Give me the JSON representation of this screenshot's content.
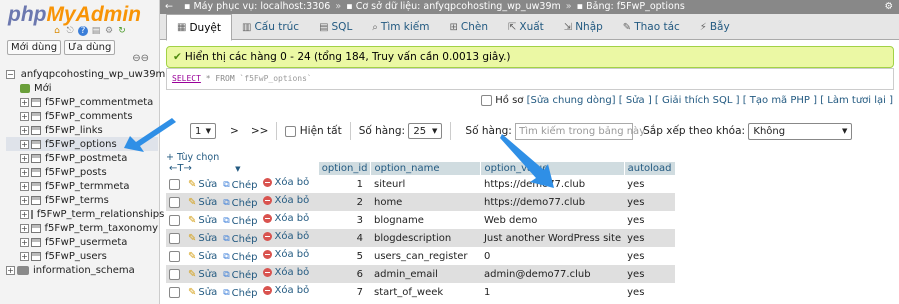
{
  "left": {
    "logo_a": "php",
    "logo_b": "MyAdmin",
    "recent_label": "Mới dùng",
    "favorites_label": "Ưa dùng",
    "database": "anfyqpcohosting_wp_uw39m",
    "new_label": "Mới",
    "tables": [
      "f5FwP_commentmeta",
      "f5FwP_comments",
      "f5FwP_links",
      "f5FwP_options",
      "f5FwP_postmeta",
      "f5FwP_posts",
      "f5FwP_termmeta",
      "f5FwP_terms",
      "f5FwP_term_relationships",
      "f5FwP_term_taxonomy",
      "f5FwP_usermeta",
      "f5FwP_users"
    ],
    "other_db": "information_schema"
  },
  "breadcrumb": {
    "server": "Máy phục vụ: localhost:3306",
    "database": "Cơ sở dữ liệu: anfyqpcohosting_wp_uw39m",
    "table": "Bảng: f5FwP_options"
  },
  "tabs": [
    "Duyệt",
    "Cấu trúc",
    "SQL",
    "Tìm kiếm",
    "Chèn",
    "Xuất",
    "Nhập",
    "Thao tác",
    "Bẫy"
  ],
  "success_message": "Hiển thị các hàng 0 - 24 (tổng 184, Truy vấn cần 0.0013 giây.)",
  "sql": {
    "select": "SELECT",
    "star": "*",
    "from": "FROM",
    "table": "`f5FwP_options`"
  },
  "sql_options": {
    "profiling": "Hồ sơ",
    "links": "[Sửa chung dòng] [ Sửa ] [ Giải thích SQL ] [ Tạo mã PHP ] [ Làm tươi lại ]"
  },
  "nav": {
    "page": "1",
    "next": ">",
    "last": ">>",
    "show_all": "Hiện tất",
    "rows_label": "Số hàng:",
    "rows_value": "25",
    "filter_label": "Số hàng:",
    "filter_placeholder": "Tìm kiếm trong bảng này",
    "sort_label": "Sắp xếp theo khóa:",
    "sort_value": "Không"
  },
  "options_link": "+ Tùy chọn",
  "columns": [
    "option_id",
    "option_name",
    "option_value",
    "autoload"
  ],
  "actions": {
    "edit": "Sửa",
    "copy": "Chép",
    "delete": "Xóa bỏ"
  },
  "rows": [
    {
      "id": "1",
      "name": "siteurl",
      "value": "https://demo77.club",
      "autoload": "yes"
    },
    {
      "id": "2",
      "name": "home",
      "value": "https://demo77.club",
      "autoload": "yes"
    },
    {
      "id": "3",
      "name": "blogname",
      "value": "Web demo",
      "autoload": "yes"
    },
    {
      "id": "4",
      "name": "blogdescription",
      "value": "Just another WordPress site",
      "autoload": "yes"
    },
    {
      "id": "5",
      "name": "users_can_register",
      "value": "0",
      "autoload": "yes"
    },
    {
      "id": "6",
      "name": "admin_email",
      "value": "admin@demo77.club",
      "autoload": "yes"
    },
    {
      "id": "7",
      "name": "start_of_week",
      "value": "1",
      "autoload": "yes"
    }
  ],
  "colors": {
    "arrow": "#2f8fe6",
    "header_bg": "#d0dce0",
    "success_bg": "#ebf8a4"
  }
}
